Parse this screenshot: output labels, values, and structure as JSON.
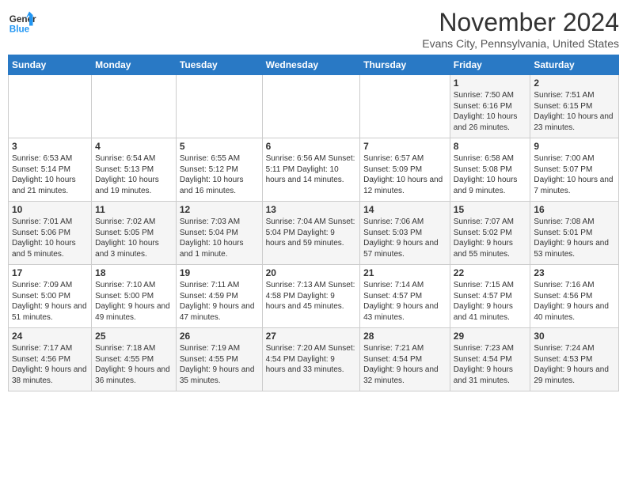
{
  "logo": {
    "line1": "General",
    "line2": "Blue"
  },
  "title": "November 2024",
  "subtitle": "Evans City, Pennsylvania, United States",
  "days_of_week": [
    "Sunday",
    "Monday",
    "Tuesday",
    "Wednesday",
    "Thursday",
    "Friday",
    "Saturday"
  ],
  "weeks": [
    [
      {
        "day": "",
        "info": ""
      },
      {
        "day": "",
        "info": ""
      },
      {
        "day": "",
        "info": ""
      },
      {
        "day": "",
        "info": ""
      },
      {
        "day": "",
        "info": ""
      },
      {
        "day": "1",
        "info": "Sunrise: 7:50 AM\nSunset: 6:16 PM\nDaylight: 10 hours and 26 minutes."
      },
      {
        "day": "2",
        "info": "Sunrise: 7:51 AM\nSunset: 6:15 PM\nDaylight: 10 hours and 23 minutes."
      }
    ],
    [
      {
        "day": "3",
        "info": "Sunrise: 6:53 AM\nSunset: 5:14 PM\nDaylight: 10 hours and 21 minutes."
      },
      {
        "day": "4",
        "info": "Sunrise: 6:54 AM\nSunset: 5:13 PM\nDaylight: 10 hours and 19 minutes."
      },
      {
        "day": "5",
        "info": "Sunrise: 6:55 AM\nSunset: 5:12 PM\nDaylight: 10 hours and 16 minutes."
      },
      {
        "day": "6",
        "info": "Sunrise: 6:56 AM\nSunset: 5:11 PM\nDaylight: 10 hours and 14 minutes."
      },
      {
        "day": "7",
        "info": "Sunrise: 6:57 AM\nSunset: 5:09 PM\nDaylight: 10 hours and 12 minutes."
      },
      {
        "day": "8",
        "info": "Sunrise: 6:58 AM\nSunset: 5:08 PM\nDaylight: 10 hours and 9 minutes."
      },
      {
        "day": "9",
        "info": "Sunrise: 7:00 AM\nSunset: 5:07 PM\nDaylight: 10 hours and 7 minutes."
      }
    ],
    [
      {
        "day": "10",
        "info": "Sunrise: 7:01 AM\nSunset: 5:06 PM\nDaylight: 10 hours and 5 minutes."
      },
      {
        "day": "11",
        "info": "Sunrise: 7:02 AM\nSunset: 5:05 PM\nDaylight: 10 hours and 3 minutes."
      },
      {
        "day": "12",
        "info": "Sunrise: 7:03 AM\nSunset: 5:04 PM\nDaylight: 10 hours and 1 minute."
      },
      {
        "day": "13",
        "info": "Sunrise: 7:04 AM\nSunset: 5:04 PM\nDaylight: 9 hours and 59 minutes."
      },
      {
        "day": "14",
        "info": "Sunrise: 7:06 AM\nSunset: 5:03 PM\nDaylight: 9 hours and 57 minutes."
      },
      {
        "day": "15",
        "info": "Sunrise: 7:07 AM\nSunset: 5:02 PM\nDaylight: 9 hours and 55 minutes."
      },
      {
        "day": "16",
        "info": "Sunrise: 7:08 AM\nSunset: 5:01 PM\nDaylight: 9 hours and 53 minutes."
      }
    ],
    [
      {
        "day": "17",
        "info": "Sunrise: 7:09 AM\nSunset: 5:00 PM\nDaylight: 9 hours and 51 minutes."
      },
      {
        "day": "18",
        "info": "Sunrise: 7:10 AM\nSunset: 5:00 PM\nDaylight: 9 hours and 49 minutes."
      },
      {
        "day": "19",
        "info": "Sunrise: 7:11 AM\nSunset: 4:59 PM\nDaylight: 9 hours and 47 minutes."
      },
      {
        "day": "20",
        "info": "Sunrise: 7:13 AM\nSunset: 4:58 PM\nDaylight: 9 hours and 45 minutes."
      },
      {
        "day": "21",
        "info": "Sunrise: 7:14 AM\nSunset: 4:57 PM\nDaylight: 9 hours and 43 minutes."
      },
      {
        "day": "22",
        "info": "Sunrise: 7:15 AM\nSunset: 4:57 PM\nDaylight: 9 hours and 41 minutes."
      },
      {
        "day": "23",
        "info": "Sunrise: 7:16 AM\nSunset: 4:56 PM\nDaylight: 9 hours and 40 minutes."
      }
    ],
    [
      {
        "day": "24",
        "info": "Sunrise: 7:17 AM\nSunset: 4:56 PM\nDaylight: 9 hours and 38 minutes."
      },
      {
        "day": "25",
        "info": "Sunrise: 7:18 AM\nSunset: 4:55 PM\nDaylight: 9 hours and 36 minutes."
      },
      {
        "day": "26",
        "info": "Sunrise: 7:19 AM\nSunset: 4:55 PM\nDaylight: 9 hours and 35 minutes."
      },
      {
        "day": "27",
        "info": "Sunrise: 7:20 AM\nSunset: 4:54 PM\nDaylight: 9 hours and 33 minutes."
      },
      {
        "day": "28",
        "info": "Sunrise: 7:21 AM\nSunset: 4:54 PM\nDaylight: 9 hours and 32 minutes."
      },
      {
        "day": "29",
        "info": "Sunrise: 7:23 AM\nSunset: 4:54 PM\nDaylight: 9 hours and 31 minutes."
      },
      {
        "day": "30",
        "info": "Sunrise: 7:24 AM\nSunset: 4:53 PM\nDaylight: 9 hours and 29 minutes."
      }
    ]
  ]
}
